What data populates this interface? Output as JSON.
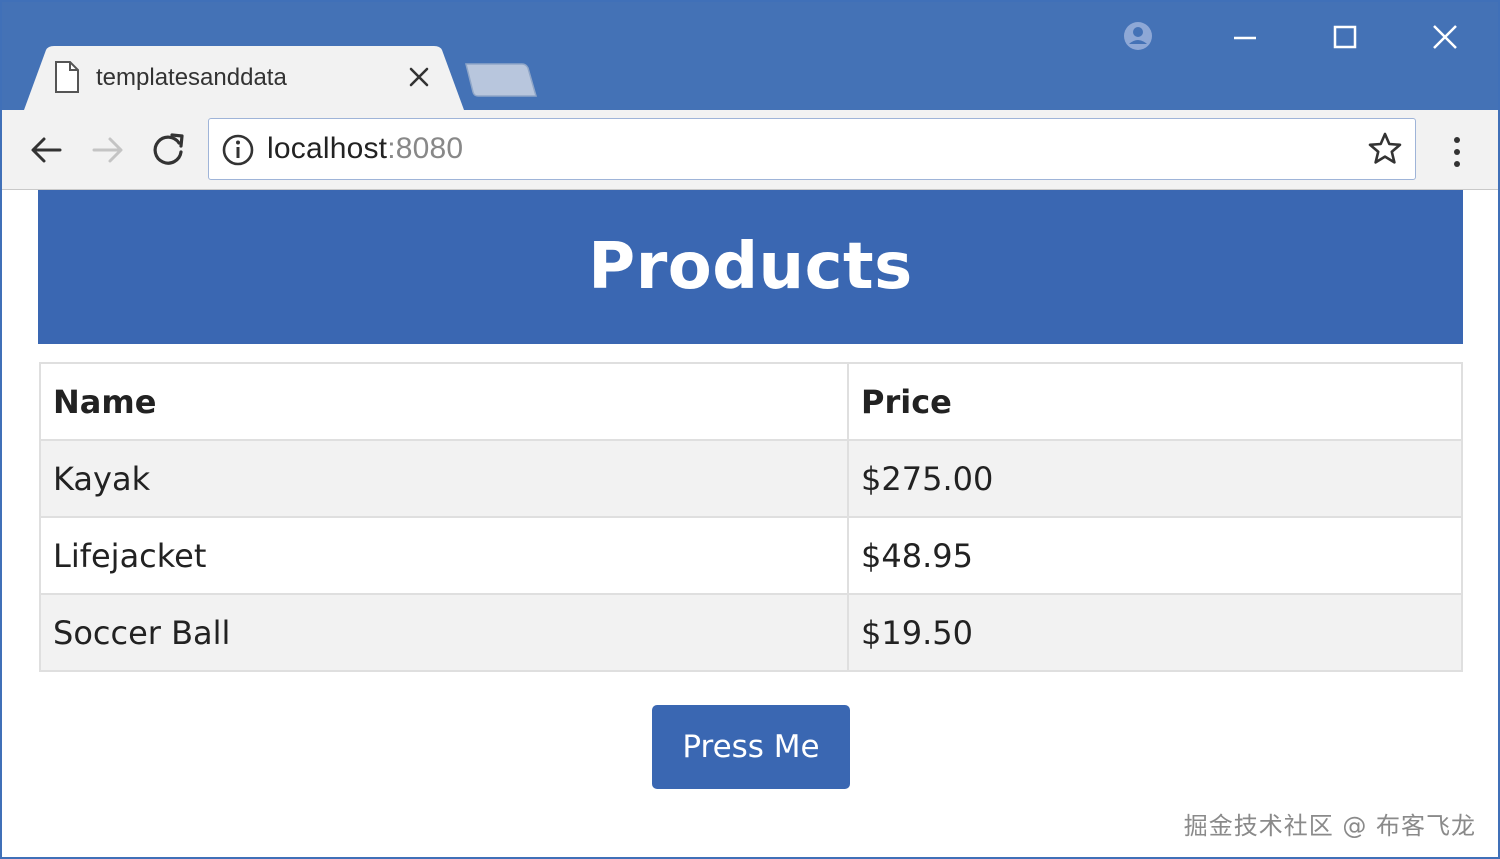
{
  "window": {
    "tab_title": "templatesanddata",
    "colors": {
      "chrome": "#4472b6",
      "tab": "#f2f2f2",
      "toolbar": "#f2f2f2"
    }
  },
  "toolbar": {
    "url_host": "localhost",
    "url_port": ":8080"
  },
  "page": {
    "heading": "Products",
    "colors": {
      "primary": "#3a67b2",
      "stripe": "#f2f2f2"
    },
    "table": {
      "headers": {
        "name": "Name",
        "price": "Price"
      },
      "rows": [
        {
          "name": "Kayak",
          "price": "$275.00"
        },
        {
          "name": "Lifejacket",
          "price": "$48.95"
        },
        {
          "name": "Soccer Ball",
          "price": "$19.50"
        }
      ]
    },
    "button_label": "Press Me"
  },
  "watermark": "掘金技术社区 @ 布客飞龙"
}
